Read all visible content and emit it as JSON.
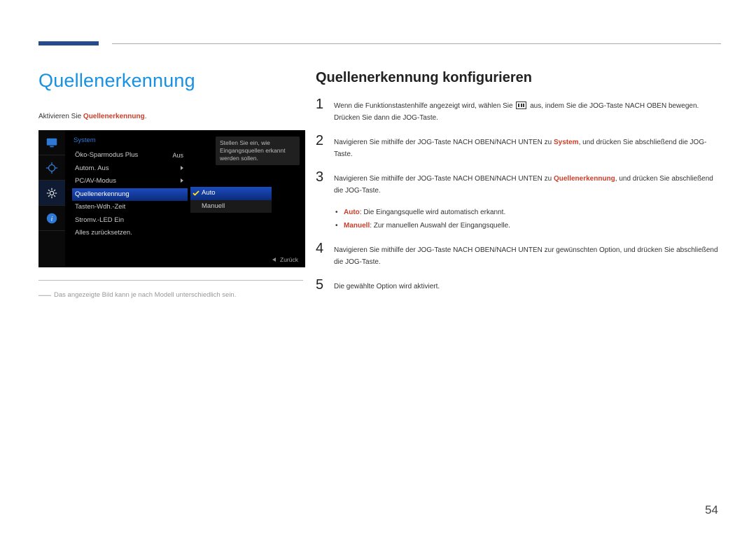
{
  "page_number": "54",
  "left": {
    "heading": "Quellenerkennung",
    "intro_pre": "Aktivieren Sie ",
    "intro_kw": "Quellenerkennung",
    "intro_post": ".",
    "menu": {
      "header": "System",
      "items": [
        {
          "label": "Öko-Sparmodus Plus",
          "val": "Aus"
        },
        {
          "label": "Autom. Aus",
          "val": ""
        },
        {
          "label": "PC/AV-Modus",
          "val": ""
        },
        {
          "label": "Quellenerkennung",
          "val": ""
        },
        {
          "label": "Tasten-Wdh.-Zeit",
          "val": ""
        },
        {
          "label": "Stromv.-LED Ein",
          "val": ""
        },
        {
          "label": "Alles zurücksetzen.",
          "val": ""
        }
      ],
      "hint": "Stellen Sie ein, wie Eingangsquellen erkannt werden sollen.",
      "sub": [
        "Auto",
        "Manuell"
      ],
      "back": "Zurück"
    },
    "footnote": "Das angezeigte Bild kann je nach Modell unterschiedlich sein."
  },
  "right": {
    "heading": "Quellenerkennung konfigurieren",
    "steps": {
      "1_a": "Wenn die Funktionstastenhilfe angezeigt wird, wählen Sie ",
      "1_b": " aus, indem Sie die JOG-Taste NACH OBEN bewegen. Drücken Sie dann die JOG-Taste.",
      "2_a": "Navigieren Sie mithilfe der JOG-Taste NACH OBEN/NACH UNTEN zu ",
      "2_kw": "System",
      "2_b": ", und drücken Sie abschließend die JOG-Taste.",
      "3_a": "Navigieren Sie mithilfe der JOG-Taste NACH OBEN/NACH UNTEN zu ",
      "3_kw": "Quellenerkennung",
      "3_b": ", und drücken Sie abschließend die JOG-Taste.",
      "bullets": [
        {
          "kw": "Auto",
          "txt": ": Die Eingangsquelle wird automatisch erkannt."
        },
        {
          "kw": "Manuell",
          "txt": ": Zur manuellen Auswahl der Eingangsquelle."
        }
      ],
      "4": "Navigieren Sie mithilfe der JOG-Taste NACH OBEN/NACH UNTEN zur gewünschten Option, und drücken Sie abschließend die JOG-Taste.",
      "5": "Die gewählte Option wird aktiviert."
    }
  }
}
